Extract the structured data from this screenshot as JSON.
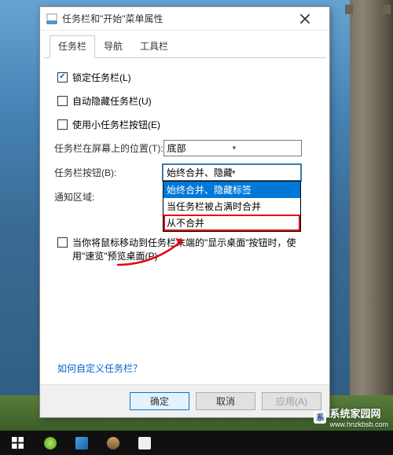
{
  "window": {
    "title": "任务栏和\"开始\"菜单属性"
  },
  "tabs": [
    "任务栏",
    "导航",
    "工具栏"
  ],
  "checkboxes": {
    "lock": {
      "label": "锁定任务栏(L)",
      "checked": true
    },
    "hide": {
      "label": "自动隐藏任务栏(U)",
      "checked": false
    },
    "small": {
      "label": "使用小任务栏按钮(E)",
      "checked": false
    },
    "peek": {
      "label": "当你将鼠标移动到任务栏末端的\"显示桌面\"按钮时，使用\"速览\"预览桌面(P)",
      "checked": false
    }
  },
  "labels": {
    "position": "任务栏在屏幕上的位置(T):",
    "buttons": "任务栏按钮(B):",
    "notify": "通知区域:"
  },
  "selects": {
    "position": {
      "value": "底部"
    },
    "buttons": {
      "value": "始终合并、隐藏标签",
      "options": [
        "始终合并、隐藏标签",
        "当任务栏被占满时合并",
        "从不合并"
      ],
      "selected_index": 0,
      "highlighted_index": 2
    }
  },
  "link": "如何自定义任务栏？",
  "buttons_row": {
    "ok": "确定",
    "cancel": "取消",
    "apply": "应用(A)"
  },
  "watermark": {
    "brand_cn": "系统家园网",
    "brand_url": "www.hnzkbsb.com"
  }
}
